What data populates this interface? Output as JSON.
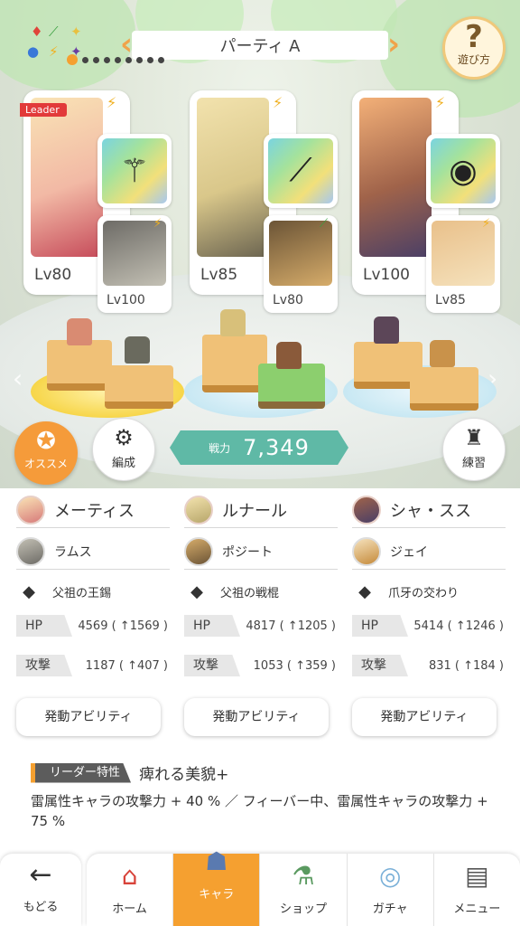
{
  "party": {
    "title": "パーティ A",
    "page_count": 9,
    "current_page": 1
  },
  "help": {
    "label": "遊び方"
  },
  "elements": [
    "♦",
    "⟋",
    "✦",
    "●",
    "⚡",
    "✦"
  ],
  "team": [
    {
      "leader_tag": "Leader",
      "main": {
        "level": "Lv80",
        "name": "メーティス"
      },
      "weapon": {
        "name": "父祖の王錫"
      },
      "sub": {
        "level": "Lv100",
        "name": "ラムス"
      },
      "hp": {
        "label": "HP",
        "value": "4569 ( ↑1569 )"
      },
      "atk": {
        "label": "攻撃",
        "value": "1187 ( ↑407 )"
      },
      "ability": "発動アビリティ"
    },
    {
      "main": {
        "level": "Lv85",
        "name": "ルナール"
      },
      "weapon": {
        "name": "父祖の戦棍"
      },
      "sub": {
        "level": "Lv80",
        "name": "ポジート"
      },
      "hp": {
        "label": "HP",
        "value": "4817 ( ↑1205 )"
      },
      "atk": {
        "label": "攻撃",
        "value": "1053 ( ↑359 )"
      },
      "ability": "発動アビリティ"
    },
    {
      "main": {
        "level": "Lv100",
        "name": "シャ・スス"
      },
      "weapon": {
        "name": "爪牙の交わり"
      },
      "sub": {
        "level": "Lv85",
        "name": "ジェイ"
      },
      "hp": {
        "label": "HP",
        "value": "5414 ( ↑1246 )"
      },
      "atk": {
        "label": "攻撃",
        "value": "831 ( ↑184 )"
      },
      "ability": "発動アビリティ"
    }
  ],
  "power": {
    "label": "戦力",
    "value": "7,349"
  },
  "buttons": {
    "recommend": "オススメ",
    "edit": "編成",
    "train": "練習"
  },
  "leader_skill": {
    "label": "リーダー特性",
    "name": "痺れる美貌+",
    "description": "雷属性キャラの攻撃力 + 40 % ／ フィーバー中、雷属性キャラの攻撃力 + 75 %"
  },
  "nav": {
    "back": "もどる",
    "items": [
      {
        "label": "ホーム",
        "icon": "home-icon"
      },
      {
        "label": "キャラ",
        "icon": "character-icon",
        "active": true
      },
      {
        "label": "ショップ",
        "icon": "shop-icon"
      },
      {
        "label": "ガチャ",
        "icon": "gacha-icon"
      },
      {
        "label": "メニュー",
        "icon": "menu-icon"
      }
    ]
  },
  "colors": {
    "accent": "#f5a030",
    "power": "#5fb9a6",
    "leader_tag": "#e23a3a"
  }
}
